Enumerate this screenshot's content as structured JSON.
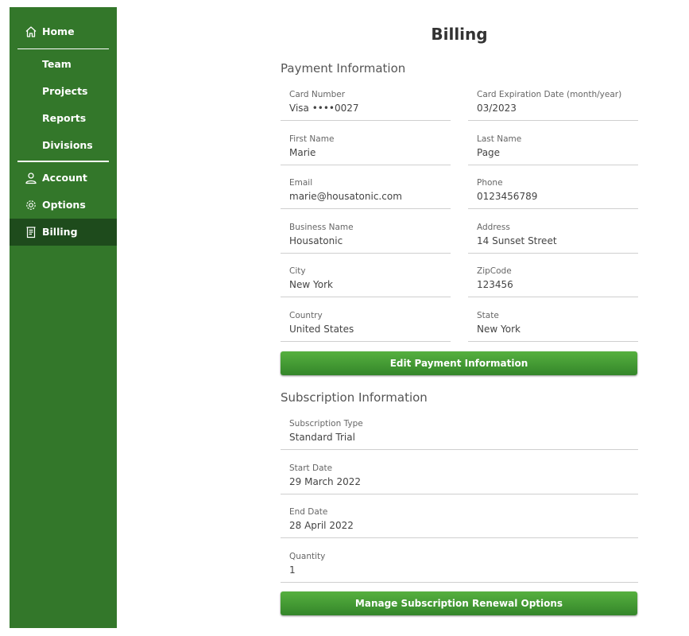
{
  "nav": {
    "home": "Home",
    "team": "Team",
    "projects": "Projects",
    "reports": "Reports",
    "divisions": "Divisions",
    "account": "Account",
    "options": "Options",
    "billing": "Billing"
  },
  "page": {
    "title": "Billing"
  },
  "payment": {
    "section_title": "Payment Information",
    "fields": [
      {
        "label": "Card Number",
        "value": "Visa ••••0027"
      },
      {
        "label": "Card Expiration Date (month/year)",
        "value": "03/2023"
      },
      {
        "label": "First Name",
        "value": "Marie"
      },
      {
        "label": "Last Name",
        "value": "Page"
      },
      {
        "label": "Email",
        "value": "marie@housatonic.com"
      },
      {
        "label": "Phone",
        "value": "0123456789"
      },
      {
        "label": "Business Name",
        "value": "Housatonic"
      },
      {
        "label": "Address",
        "value": "14 Sunset Street"
      },
      {
        "label": "City",
        "value": "New York"
      },
      {
        "label": "ZipCode",
        "value": "123456"
      },
      {
        "label": "Country",
        "value": "United States"
      },
      {
        "label": "State",
        "value": "New York"
      }
    ],
    "edit_button": "Edit Payment Information"
  },
  "subscription": {
    "section_title": "Subscription Information",
    "fields": [
      {
        "label": "Subscription Type",
        "value": "Standard Trial"
      },
      {
        "label": "Start Date",
        "value": "29 March 2022"
      },
      {
        "label": "End Date",
        "value": "28 April 2022"
      },
      {
        "label": "Quantity",
        "value": "1"
      }
    ],
    "manage_button": "Manage Subscription Renewal Options"
  },
  "colors": {
    "sidebar": "#33772a",
    "sidebar_active": "#1e4b1c",
    "button": "#3f962f"
  },
  "icons": {
    "home": "home-icon",
    "account": "user-icon",
    "options": "gear-icon",
    "billing": "receipt-icon"
  }
}
